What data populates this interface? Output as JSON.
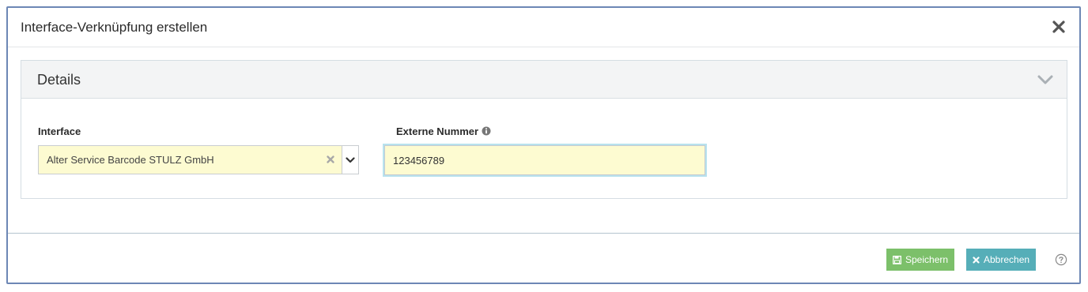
{
  "dialog": {
    "title": "Interface-Verknüpfung erstellen",
    "close_icon": "close-icon"
  },
  "panel": {
    "title": "Details",
    "toggle_icon": "chevron-down-icon"
  },
  "form": {
    "interface": {
      "label": "Interface",
      "selected_value": "Alter Service Barcode STULZ GmbH",
      "clear_icon": "clear-x-icon",
      "caret_icon": "chevron-down-icon"
    },
    "external_number": {
      "label": "Externe Nummer",
      "info_icon": "info-icon",
      "value": "123456789"
    }
  },
  "footer": {
    "save_label": "Speichern",
    "save_icon": "floppy-disk-icon",
    "cancel_label": "Abbrechen",
    "cancel_icon": "x-icon",
    "help_icon": "help-circle-icon"
  },
  "colors": {
    "save": "#7cc06a",
    "cancel": "#56aeb8",
    "input_bg": "#fdfbd1",
    "border": "#6d87b5"
  }
}
